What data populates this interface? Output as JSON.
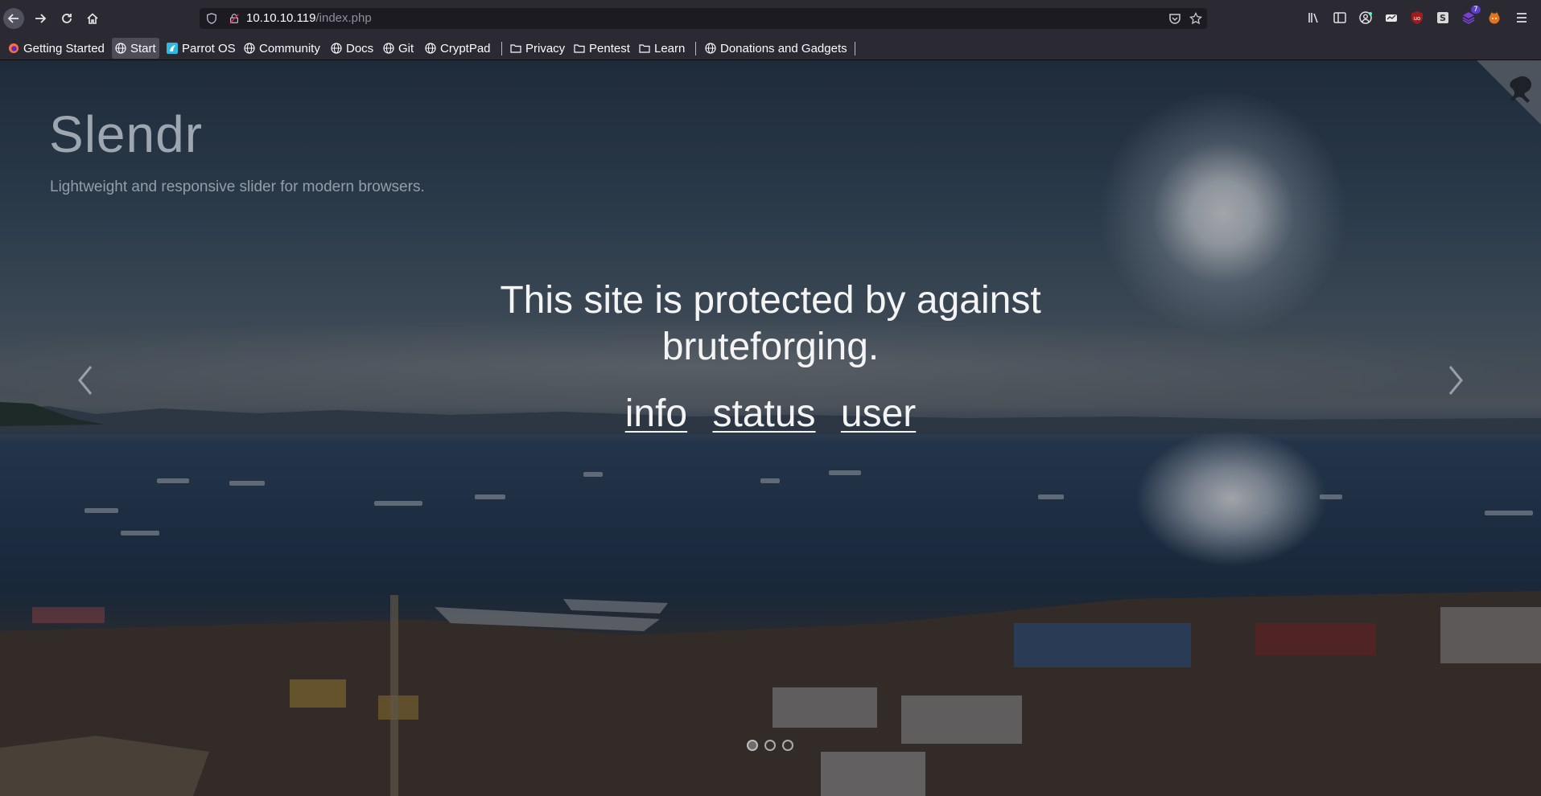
{
  "browser": {
    "url_host": "10.10.10.119",
    "url_path": "/index.php",
    "addons_badge": "7"
  },
  "bookmarks": [
    {
      "label": "Getting Started",
      "icon": "firefox-icon"
    },
    {
      "label": "Start",
      "icon": "globe-icon",
      "active": true
    },
    {
      "label": "Parrot OS",
      "icon": "parrot-icon"
    },
    {
      "label": "Community",
      "icon": "globe-icon"
    },
    {
      "label": "Docs",
      "icon": "globe-icon"
    },
    {
      "label": "Git",
      "icon": "globe-icon"
    },
    {
      "label": "CryptPad",
      "icon": "globe-icon"
    },
    {
      "label": "Privacy",
      "icon": "folder-icon"
    },
    {
      "label": "Pentest",
      "icon": "folder-icon"
    },
    {
      "label": "Learn",
      "icon": "folder-icon"
    },
    {
      "label": "Donations and Gadgets",
      "icon": "globe-icon"
    }
  ],
  "page": {
    "title": "Slendr",
    "subtitle": "Lightweight and responsive slider for modern browsers.",
    "headline": "This site is protected by against bruteforging.",
    "links": {
      "info": "info",
      "status": "status",
      "user": "user"
    },
    "slider": {
      "slide_count": 3,
      "active_slide": 1
    }
  },
  "colors": {
    "chrome_bg": "#2b2a33",
    "url_bg": "#1c1b22",
    "headline_text": "#f4f4f4"
  }
}
